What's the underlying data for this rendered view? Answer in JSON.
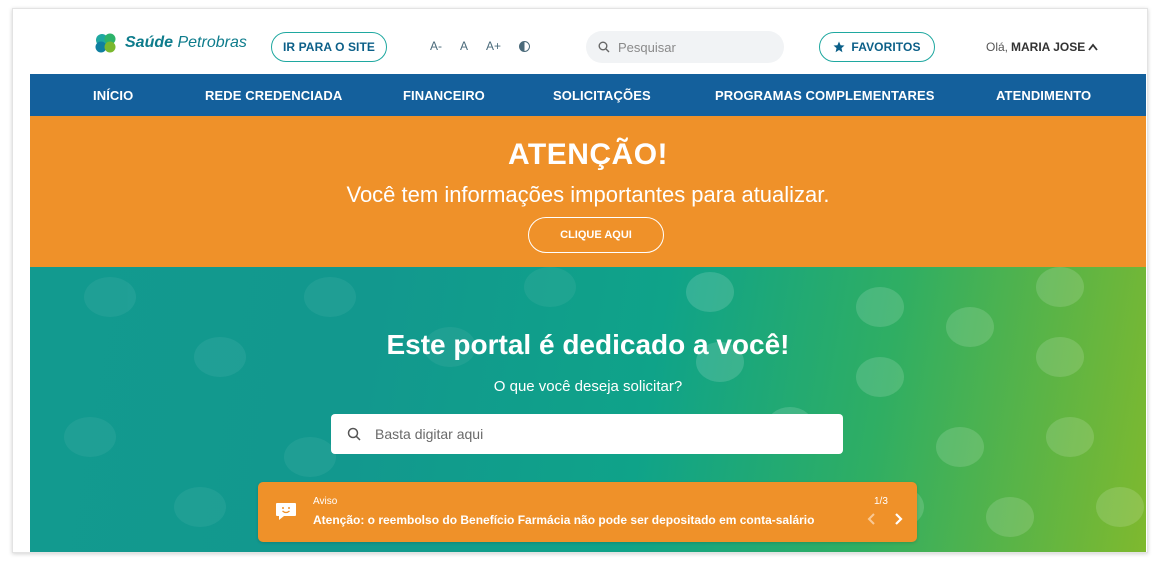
{
  "brand": {
    "name_bold": "Saúde",
    "name_rest": "Petrobras",
    "logo_icon": "cross-cloud-icon"
  },
  "header": {
    "site_button": "IR PARA O SITE",
    "font_controls": [
      "A-",
      "A",
      "A+"
    ],
    "contrast_icon": "contrast-icon",
    "search_placeholder": "Pesquisar",
    "favorites_button": "FAVORITOS",
    "greeting_prefix": "Olá,",
    "user_name": "MARIA JOSE"
  },
  "nav": {
    "items": [
      "INÍCIO",
      "REDE CREDENCIADA",
      "FINANCEIRO",
      "SOLICITAÇÕES",
      "PROGRAMAS COMPLEMENTARES",
      "ATENDIMENTO"
    ]
  },
  "alert": {
    "title": "ATENÇÃO!",
    "message": "Você tem informações importantes para atualizar.",
    "button": "CLIQUE AQUI"
  },
  "hero": {
    "title": "Este portal é dedicado a você!",
    "subtitle": "O que você deseja solicitar?",
    "search_placeholder": "Basta digitar aqui"
  },
  "notice": {
    "label": "Aviso",
    "text": "Atenção: o reembolso do Benefício Farmácia não pode ser depositado em conta-salário",
    "counter": "1/3"
  },
  "colors": {
    "nav_bg": "#14609c",
    "alert_bg": "#ef9129",
    "accent_teal": "#1fa8a0",
    "hero_start": "#129a8f",
    "hero_end": "#7fb92e"
  }
}
